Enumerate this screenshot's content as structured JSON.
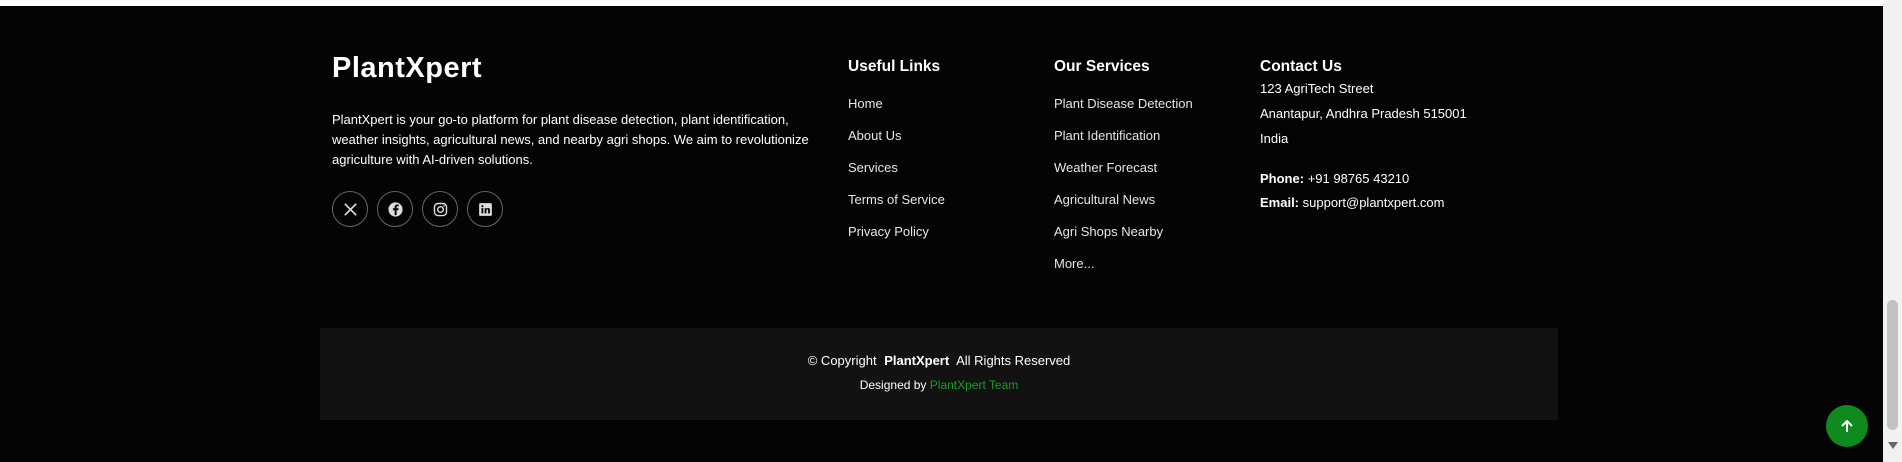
{
  "brand": {
    "title": "PlantXpert",
    "description": "PlantXpert is your go-to platform for plant disease detection, plant identification, weather insights, agricultural news, and nearby agri shops. We aim to revolutionize agriculture with AI-driven solutions."
  },
  "socials": [
    {
      "icon": "x-icon"
    },
    {
      "icon": "facebook-icon"
    },
    {
      "icon": "instagram-icon"
    },
    {
      "icon": "linkedin-icon"
    }
  ],
  "useful_links": {
    "heading": "Useful Links",
    "items": [
      "Home",
      "About Us",
      "Services",
      "Terms of Service",
      "Privacy Policy"
    ]
  },
  "services": {
    "heading": "Our Services",
    "items": [
      "Plant Disease Detection",
      "Plant Identification",
      "Weather Forecast",
      "Agricultural News",
      "Agri Shops Nearby",
      "More..."
    ]
  },
  "contact": {
    "heading": "Contact Us",
    "address": [
      "123 AgriTech Street",
      "Anantapur, Andhra Pradesh 515001",
      "India"
    ],
    "phone_label": "Phone:",
    "phone": "+91 98765 43210",
    "email_label": "Email:",
    "email": "support@plantxpert.com"
  },
  "copyright": {
    "prefix": "© Copyright",
    "brand": "PlantXpert",
    "suffix": "All Rights Reserved",
    "designed_by": "Designed by",
    "team": "PlantXpert Team"
  },
  "colors": {
    "accent": "#0f8a1f",
    "team_link": "#1a9a2c",
    "background": "#040404",
    "band": "#121212"
  },
  "back_to_top": {
    "icon": "arrow-up-icon"
  }
}
